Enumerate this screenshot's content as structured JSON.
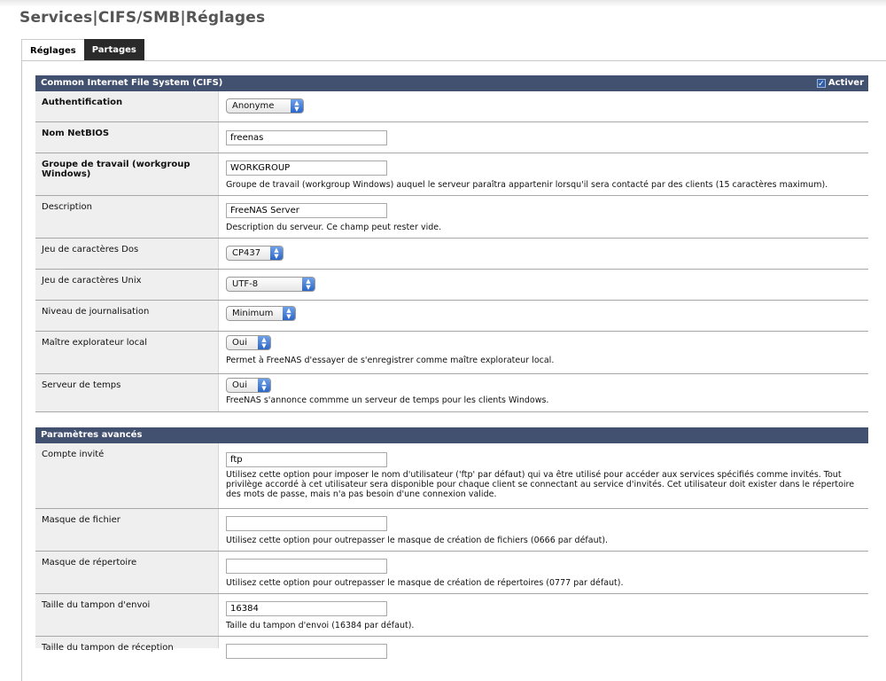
{
  "page_title": "Services|CIFS/SMB|Réglages",
  "tabs": [
    {
      "label": "Réglages",
      "active": true
    },
    {
      "label": "Partages",
      "active": false
    }
  ],
  "section_cifs": {
    "title": "Common Internet File System (CIFS)",
    "enable_label": "Activer",
    "enable_checked": true
  },
  "fields": {
    "auth": {
      "label": "Authentification",
      "value": "Anonyme"
    },
    "netbios": {
      "label": "Nom NetBIOS",
      "value": "freenas"
    },
    "workgroup": {
      "label": "Groupe de travail (workgroup Windows)",
      "value": "WORKGROUP",
      "help": "Groupe de travail (workgroup Windows) auquel le serveur paraîtra appartenir lorsqu'il sera contacté par des clients (15 caractères maximum)."
    },
    "description": {
      "label": "Description",
      "value": "FreeNAS Server",
      "help": "Description du serveur. Ce champ peut rester vide."
    },
    "doscharset": {
      "label": "Jeu de caractères Dos",
      "value": "CP437"
    },
    "unixcharset": {
      "label": "Jeu de caractères Unix",
      "value": "UTF-8"
    },
    "loglevel": {
      "label": "Niveau de journalisation",
      "value": "Minimum"
    },
    "localmaster": {
      "label": "Maître explorateur local",
      "value": "Oui",
      "help": "Permet à FreeNAS d'essayer de s'enregistrer comme maître explorateur local."
    },
    "timesrv": {
      "label": "Serveur de temps",
      "value": "Oui",
      "help": "FreeNAS s'annonce commme un serveur de temps pour les clients Windows."
    }
  },
  "section_advanced": {
    "title": "Paramètres avancés"
  },
  "advanced": {
    "guest": {
      "label": "Compte invité",
      "value": "ftp",
      "help": "Utilisez cette option pour imposer le nom d'utilisateur ('ftp' par défaut) qui va être utilisé pour accéder aux services spécifiés comme invités. Tout privilège accordé à cet utilisateur sera disponible pour chaque client se connectant au service d'invités. Cet utilisateur doit exister dans le répertoire des mots de passe, mais n'a pas besoin d'une connexion valide."
    },
    "createmask": {
      "label": "Masque de fichier",
      "value": "",
      "help": "Utilisez cette option pour outrepasser le masque de création de fichiers (0666 par défaut)."
    },
    "dirmask": {
      "label": "Masque de répertoire",
      "value": "",
      "help": "Utilisez cette option pour outrepasser le masque de création de répertoires (0777 par défaut)."
    },
    "sndbuf": {
      "label": "Taille du tampon d'envoi",
      "value": "16384",
      "help": "Taille du tampon d'envoi (16384 par défaut)."
    },
    "rcvbuf": {
      "label": "Taille du tampon de réception",
      "value": ""
    }
  },
  "colors": {
    "header_bg": "#435170",
    "label_bg": "#efefef",
    "tab_dark": "#2a2a2a"
  }
}
